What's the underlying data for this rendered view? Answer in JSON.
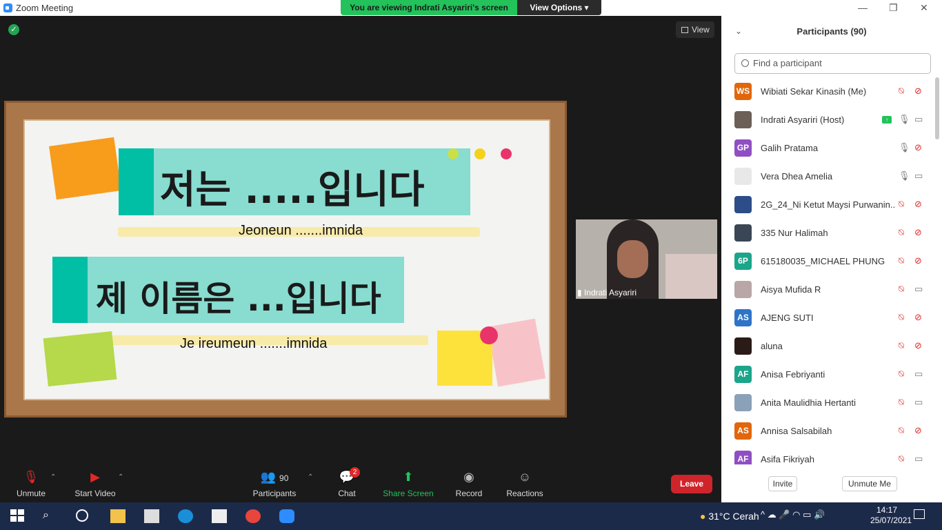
{
  "window": {
    "title": "Zoom Meeting",
    "min": "—",
    "max": "❐",
    "close": "✕"
  },
  "banner": {
    "message": "You are viewing Indrati Asyariri's screen",
    "view_options": "View Options ▾"
  },
  "stage": {
    "view_label": "View"
  },
  "slide": {
    "line1_korean": "저는 .....입니다",
    "line1_roman": "Jeoneun .......imnida",
    "line2_korean": "제 이름은 ...입니다",
    "line2_roman": "Je ireumeun .......imnida"
  },
  "video": {
    "name": "Indrati Asyariri"
  },
  "toolbar": {
    "unmute": "Unmute",
    "start_video": "Start Video",
    "participants": "Participants",
    "participants_count": "90",
    "chat": "Chat",
    "chat_badge": "2",
    "share_screen": "Share Screen",
    "record": "Record",
    "reactions": "Reactions",
    "leave": "Leave"
  },
  "panel": {
    "title": "Participants (90)",
    "search_placeholder": "Find a participant",
    "invite": "Invite",
    "unmute_me": "Unmute Me"
  },
  "participants": [
    {
      "initials": "WS",
      "name": "Wibiati Sekar Kinasih (Me)",
      "color": "#e1660c",
      "mic": "muted",
      "video": "off"
    },
    {
      "initials": "",
      "name": "Indrati Asyariri (Host)",
      "color": "#6b5f58",
      "mic": "on",
      "video": "on",
      "sharing": true
    },
    {
      "initials": "GP",
      "name": "Galih Pratama",
      "color": "#8f4fc2",
      "mic": "on",
      "video": "off"
    },
    {
      "initials": "",
      "name": "Vera Dhea Amelia",
      "color": "#e8e8e8",
      "mic": "on",
      "video": "on"
    },
    {
      "initials": "",
      "name": "2G_24_Ni Ketut Maysi Purwanin...",
      "color": "#2c4d8a",
      "mic": "muted",
      "video": "off"
    },
    {
      "initials": "",
      "name": "335 Nur Halimah",
      "color": "#3a4655",
      "mic": "muted",
      "video": "off"
    },
    {
      "initials": "6P",
      "name": "615180035_MICHAEL PHUNG",
      "color": "#1ba58a",
      "mic": "muted",
      "video": "off"
    },
    {
      "initials": "",
      "name": "Aisya Mufida R",
      "color": "#b9a6a6",
      "mic": "muted",
      "video": "on"
    },
    {
      "initials": "AS",
      "name": "AJENG SUTI",
      "color": "#2d74c8",
      "mic": "muted",
      "video": "off"
    },
    {
      "initials": "",
      "name": "aluna",
      "color": "#2a1b18",
      "mic": "muted",
      "video": "off"
    },
    {
      "initials": "AF",
      "name": "Anisa Febriyanti",
      "color": "#1ba58a",
      "mic": "muted",
      "video": "on"
    },
    {
      "initials": "",
      "name": "Anita Maulidhia Hertanti",
      "color": "#8aa1b8",
      "mic": "muted",
      "video": "on"
    },
    {
      "initials": "AS",
      "name": "Annisa Salsabilah",
      "color": "#e1660c",
      "mic": "muted",
      "video": "off"
    },
    {
      "initials": "AF",
      "name": "Asifa Fikriyah",
      "color": "#8f4fc2",
      "mic": "muted",
      "video": "on"
    }
  ],
  "taskbar": {
    "temp": "31°C",
    "weather": "Cerah",
    "time": "14:17",
    "date": "25/07/2021"
  }
}
